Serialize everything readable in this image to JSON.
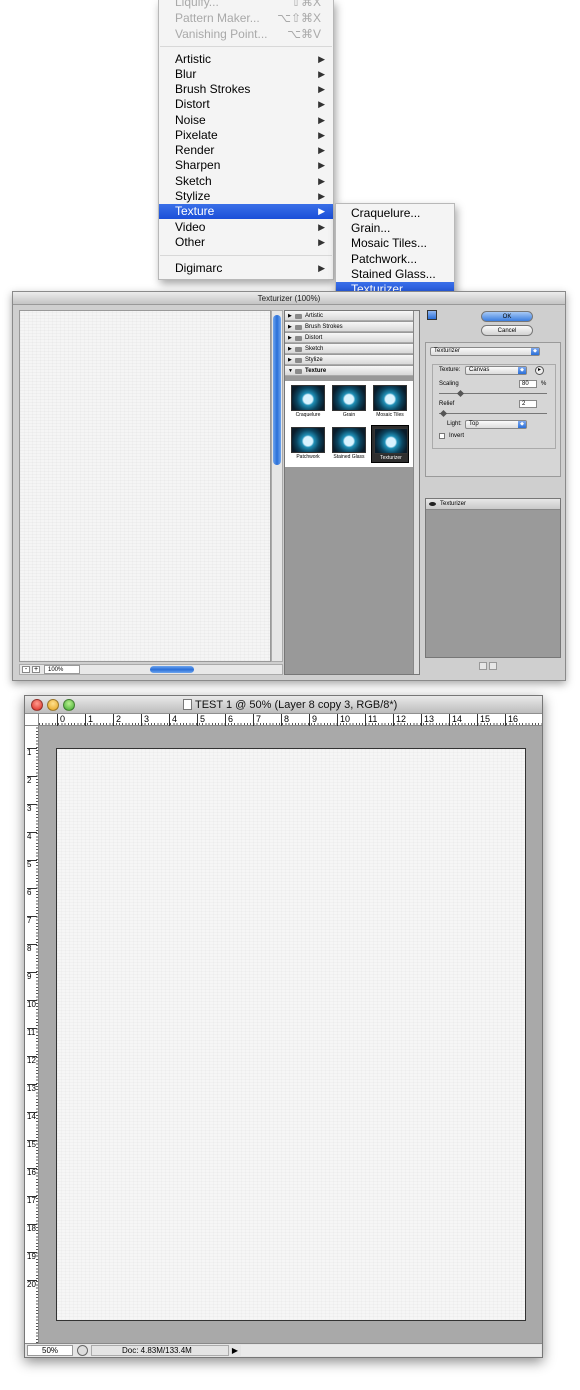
{
  "menu": {
    "top_items": [
      {
        "label": "Liquify...",
        "shortcut": "⇧⌘X"
      },
      {
        "label": "Pattern Maker...",
        "shortcut": "⌥⇧⌘X"
      },
      {
        "label": "Vanishing Point...",
        "shortcut": "⌥⌘V"
      }
    ],
    "items": [
      {
        "label": "Artistic"
      },
      {
        "label": "Blur"
      },
      {
        "label": "Brush Strokes"
      },
      {
        "label": "Distort"
      },
      {
        "label": "Noise"
      },
      {
        "label": "Pixelate"
      },
      {
        "label": "Render"
      },
      {
        "label": "Sharpen"
      },
      {
        "label": "Sketch"
      },
      {
        "label": "Stylize"
      },
      {
        "label": "Texture"
      },
      {
        "label": "Video"
      },
      {
        "label": "Other"
      }
    ],
    "bottom_item": {
      "label": "Digimarc"
    },
    "arrow": "▶",
    "submenu": [
      "Craquelure...",
      "Grain...",
      "Mosaic Tiles...",
      "Patchwork...",
      "Stained Glass...",
      "Texturizer..."
    ],
    "highlight_color": "#2a5ee0"
  },
  "dialog": {
    "title": "Texturizer (100%)",
    "zoom": "100%",
    "categories": [
      "Artistic",
      "Brush Strokes",
      "Distort",
      "Sketch",
      "Stylize",
      "Texture"
    ],
    "thumbs": [
      "Craquelure",
      "Grain",
      "Mosaic Tiles",
      "Patchwork",
      "Stained Glass",
      "Texturizer"
    ],
    "ok_label": "OK",
    "cancel_label": "Cancel",
    "filter_select": "Texturizer",
    "texture_label": "Texture:",
    "texture_value": "Canvas",
    "scaling_label": "Scaling",
    "scaling_value": "80",
    "percent": "%",
    "relief_label": "Relief",
    "relief_value": "2",
    "light_label": "Light:",
    "light_value": "Top",
    "invert_label": "Invert",
    "effect_layer": "Texturizer"
  },
  "document": {
    "title": "TEST 1 @ 50% (Layer 8 copy 3, RGB/8*)",
    "ruler_h": [
      "0",
      "1",
      "2",
      "3",
      "4",
      "5",
      "6",
      "7",
      "8",
      "9",
      "10",
      "11",
      "12",
      "13",
      "14",
      "15",
      "16"
    ],
    "ruler_v": [
      "1",
      "2",
      "3",
      "4",
      "5",
      "6",
      "7",
      "8",
      "9",
      "10",
      "11",
      "12",
      "13",
      "14",
      "15",
      "16",
      "17",
      "18",
      "19",
      "20"
    ],
    "zoom": "50%",
    "doc_size": "Doc: 4.83M/133.4M",
    "arrow": "▶"
  }
}
